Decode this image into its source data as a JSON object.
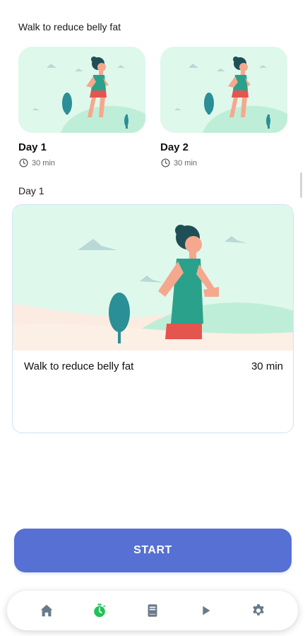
{
  "header": {
    "title": "Walk to reduce belly fat"
  },
  "cards": [
    {
      "title": "Day 1",
      "duration": "30 min"
    },
    {
      "title": "Day 2",
      "duration": "30 min"
    }
  ],
  "selected": {
    "subtitle": "Day 1",
    "name": "Walk to reduce belly fat",
    "duration": "30 min"
  },
  "start_button": {
    "label": "START"
  },
  "nav": {
    "items": [
      {
        "icon": "home-icon",
        "active": false
      },
      {
        "icon": "stopwatch-icon",
        "active": true
      },
      {
        "icon": "book-icon",
        "active": false
      },
      {
        "icon": "play-icon",
        "active": false
      },
      {
        "icon": "gear-icon",
        "active": false
      }
    ]
  },
  "colors": {
    "accent": "#5670d4",
    "active_nav": "#21c25a",
    "inactive_nav": "#687a8a",
    "illustration_bg": "#dff8ec",
    "skin": "#f5a88e",
    "shirt": "#2aa18b",
    "shorts": "#e4554f",
    "hair": "#1f4f55"
  }
}
